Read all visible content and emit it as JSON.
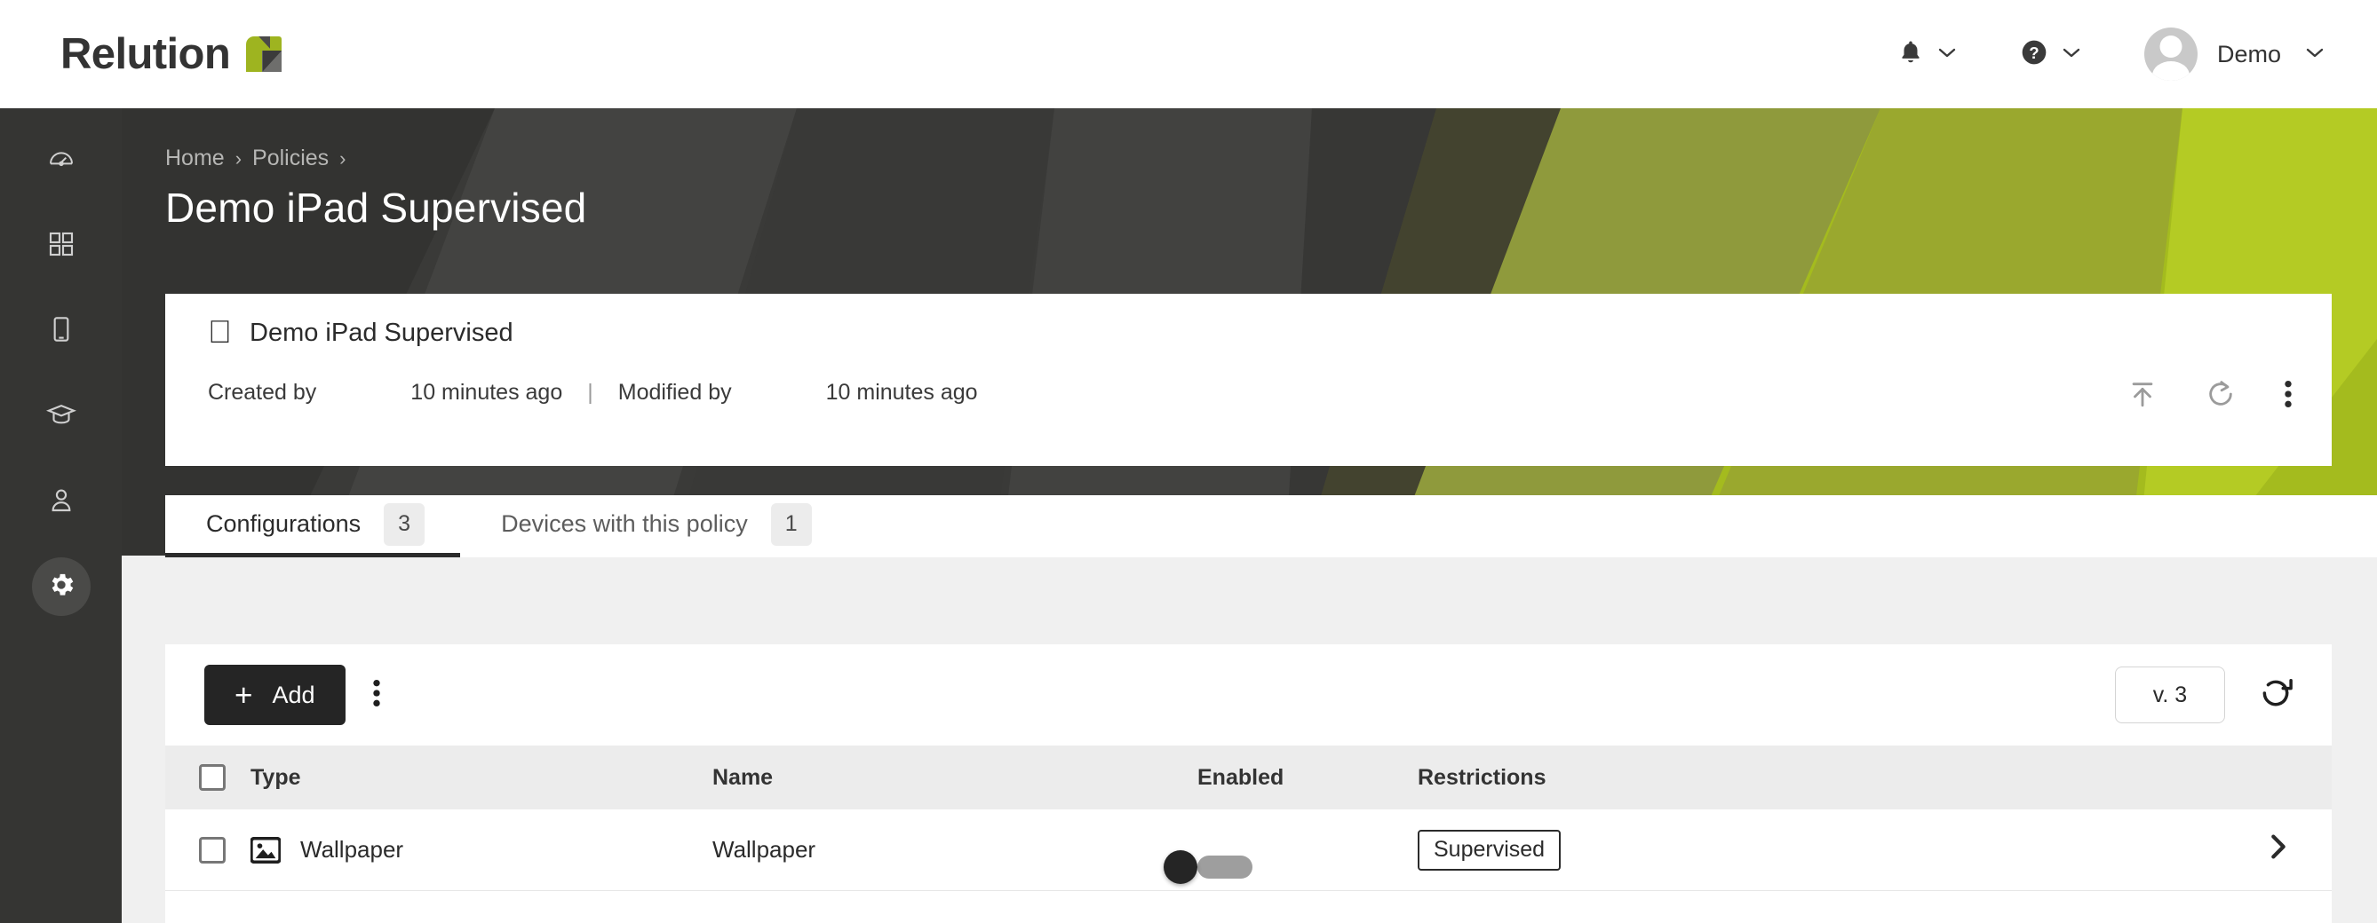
{
  "brand": {
    "name": "Relution",
    "mark": "relution-logo-mark",
    "accent": "#9eb420"
  },
  "topbar": {
    "notifications_icon": "bell-icon",
    "help_icon": "question-circle-icon",
    "chevron_icon": "chevron-down-icon",
    "user": {
      "name": "Demo",
      "avatar": "user-avatar"
    }
  },
  "sidebar": {
    "items": [
      {
        "icon": "dashboard-gauge-icon",
        "active": false
      },
      {
        "icon": "apps-grid-icon",
        "active": false
      },
      {
        "icon": "device-tablet-icon",
        "active": false
      },
      {
        "icon": "graduation-cap-icon",
        "active": false
      },
      {
        "icon": "user-icon",
        "active": false
      },
      {
        "icon": "gear-icon",
        "active": true
      }
    ]
  },
  "hero": {
    "breadcrumb": [
      "Home",
      "Policies"
    ],
    "separator": "›",
    "title": "Demo iPad Supervised",
    "bg_dark": "#3a3a38",
    "bg_green": "#a4bb1e"
  },
  "info_card": {
    "platform_icon": "apple-icon",
    "title": "Demo iPad Supervised",
    "created_by_label": "Created by",
    "created_by_user": "",
    "created_at": "10 minutes ago",
    "divider": "|",
    "modified_by_label": "Modified by",
    "modified_by_user": "",
    "modified_at": "10 minutes ago",
    "actions": [
      {
        "icon": "publish-upload-icon"
      },
      {
        "icon": "restore-undo-icon"
      },
      {
        "icon": "more-vertical-icon"
      }
    ]
  },
  "tabs": [
    {
      "label": "Configurations",
      "badge": "3",
      "active": true
    },
    {
      "label": "Devices with this policy",
      "badge": "1",
      "active": false
    }
  ],
  "toolbar": {
    "add_label": "Add",
    "add_icon": "plus-icon",
    "more_icon": "more-vertical-icon",
    "version_label": "v. 3",
    "refresh_icon": "refresh-icon"
  },
  "table": {
    "columns": [
      "Type",
      "Name",
      "Enabled",
      "Restrictions"
    ],
    "select_all_checkbox": "select-all-checkbox",
    "rows": [
      {
        "checked": false,
        "type_icon": "image-picture-icon",
        "type": "Wallpaper",
        "name": "Wallpaper",
        "enabled": true,
        "restriction": "Supervised",
        "arrow_icon": "chevron-right-icon"
      }
    ]
  }
}
